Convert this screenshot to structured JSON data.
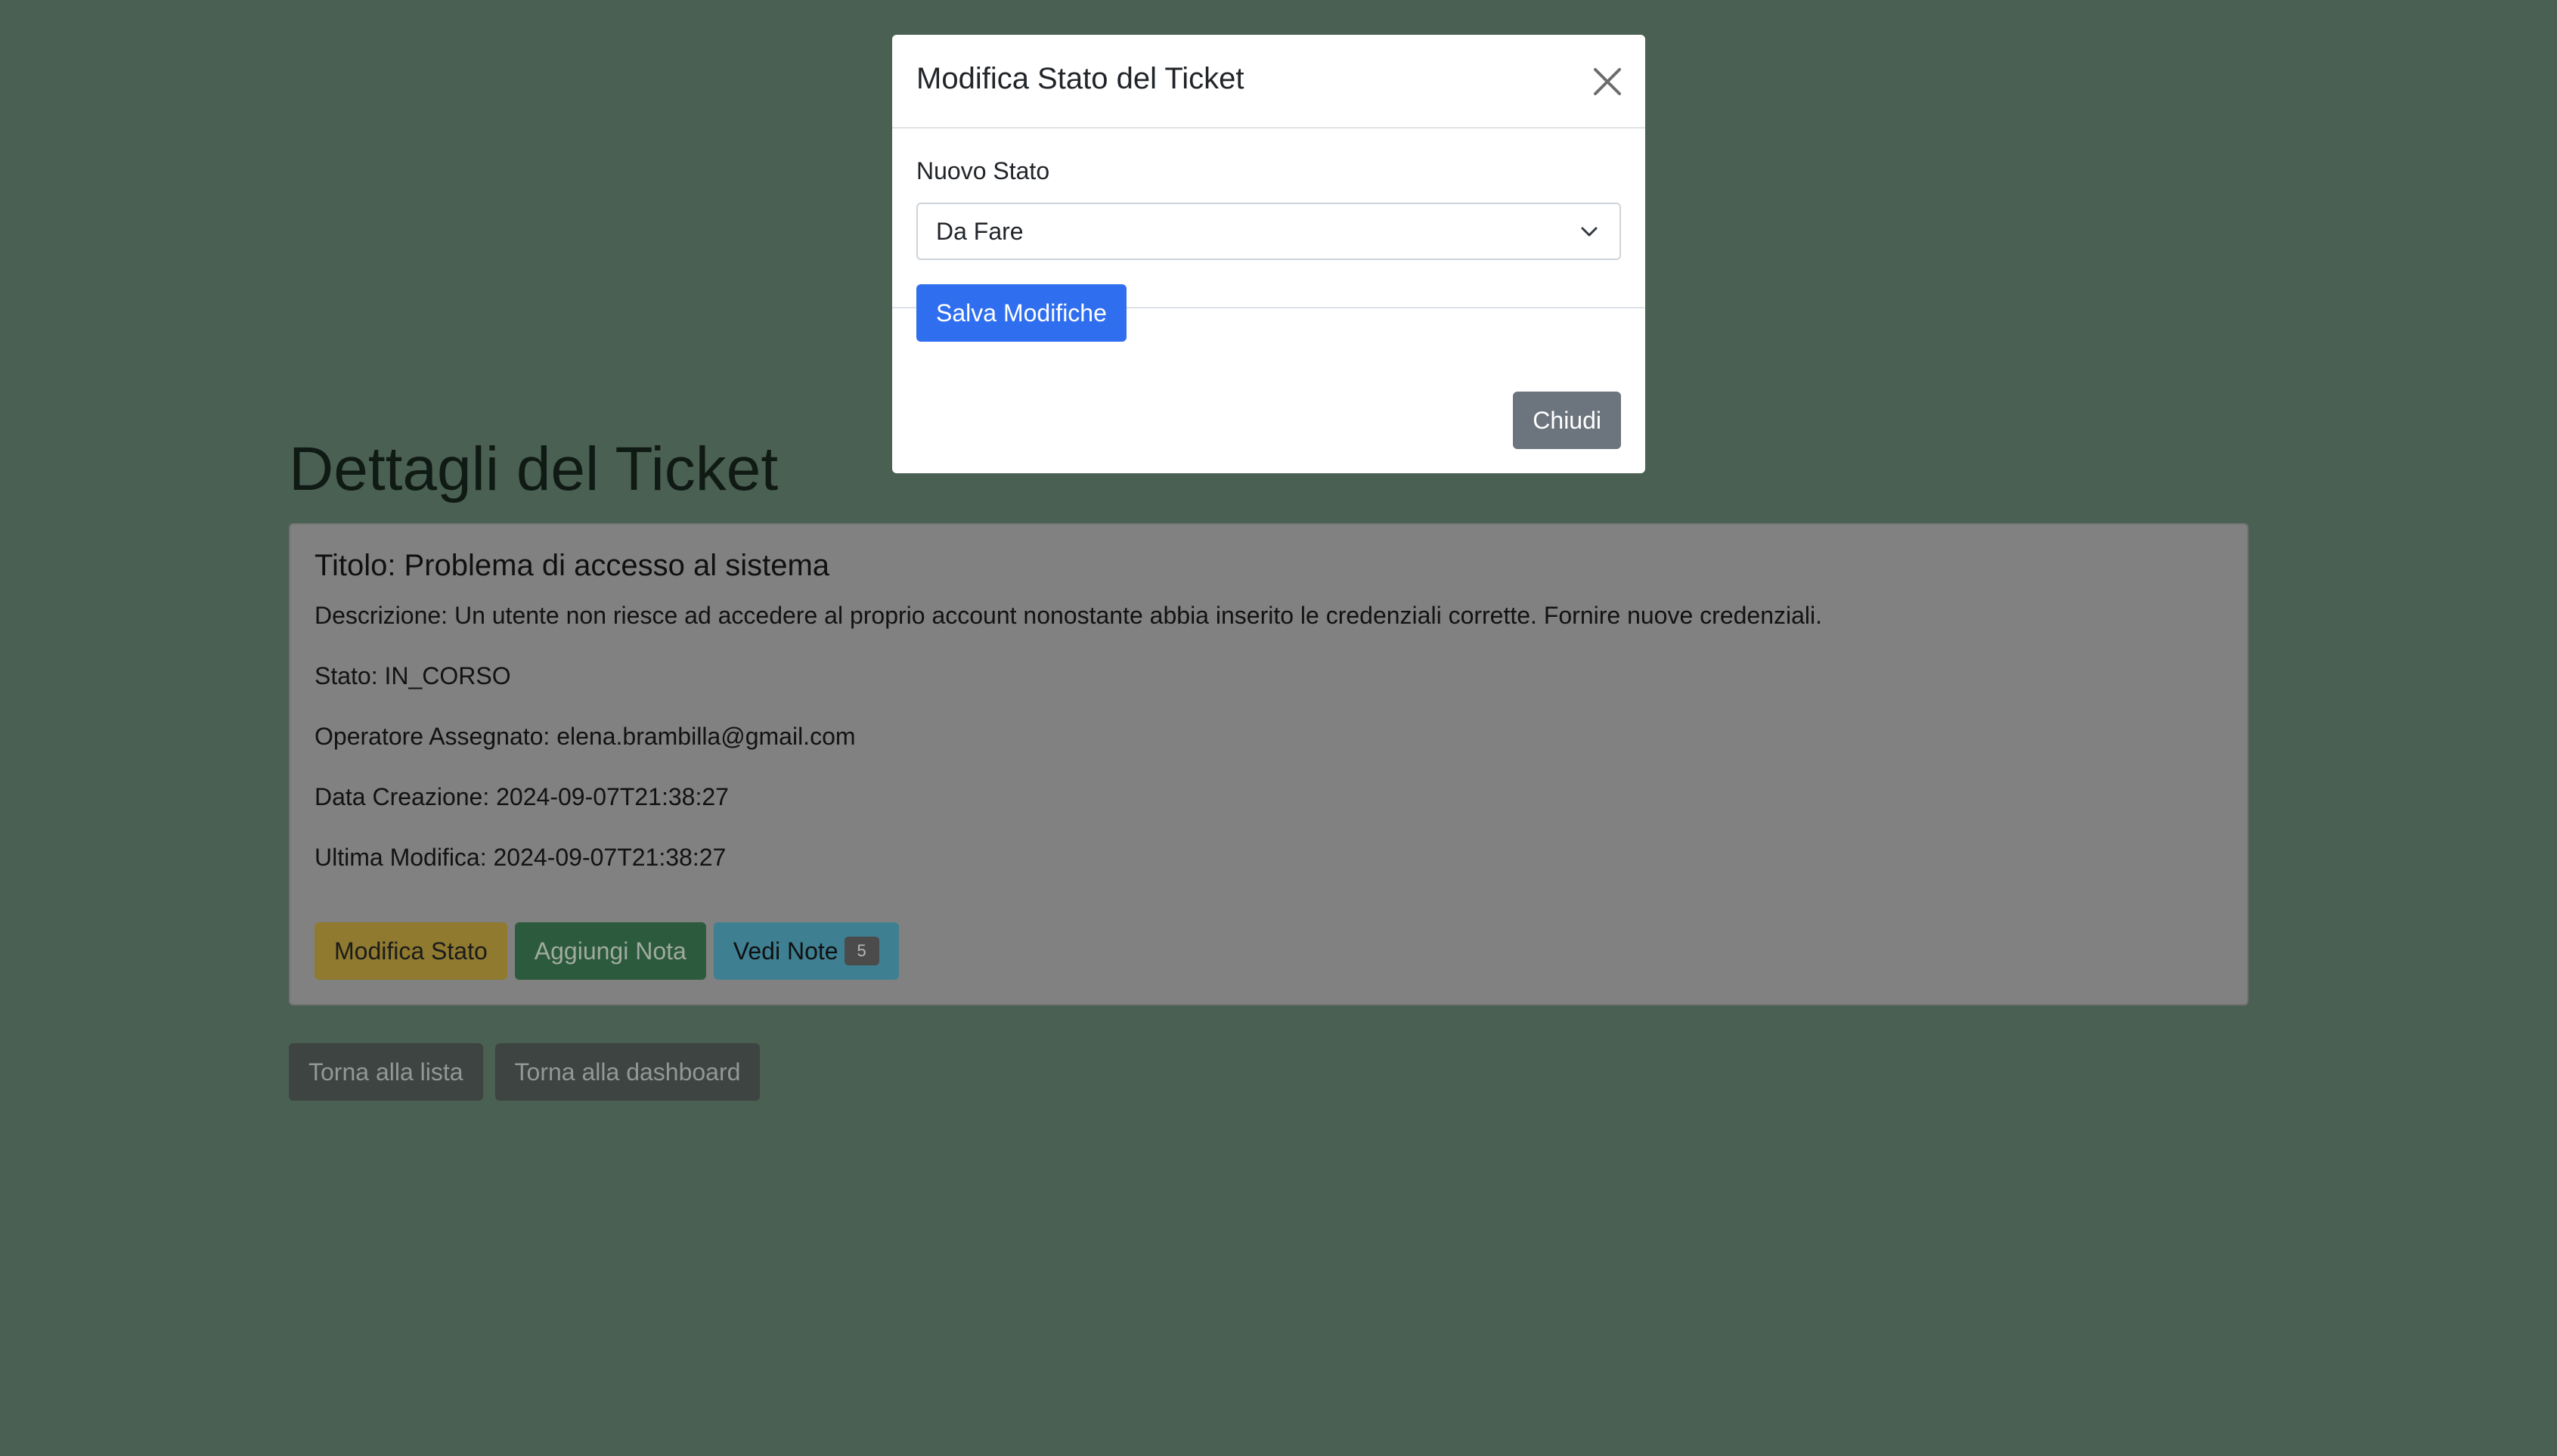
{
  "page": {
    "title": "Dettagli del Ticket"
  },
  "ticket": {
    "title": "Titolo: Problema di accesso al sistema",
    "description": "Descrizione: Un utente non riesce ad accedere al proprio account nonostante abbia inserito le credenziali corrette. Fornire nuove credenziali.",
    "status": "Stato: IN_CORSO",
    "operator": "Operatore Assegnato: elena.brambilla@gmail.com",
    "created": "Data Creazione: 2024-09-07T21:38:27",
    "modified": "Ultima Modifica: 2024-09-07T21:38:27"
  },
  "ticket_actions": {
    "edit_status": "Modifica Stato",
    "add_note": "Aggiungi Nota",
    "view_notes": "Vedi Note",
    "notes_count": "5"
  },
  "page_actions": {
    "back_to_list": "Torna alla lista",
    "back_to_dashboard": "Torna alla dashboard"
  },
  "modal": {
    "title": "Modifica Stato del Ticket",
    "close_icon": "close-icon",
    "field_label": "Nuovo Stato",
    "selected_status": "Da Fare",
    "save_label": "Salva Modifiche",
    "close_label": "Chiudi"
  },
  "colors": {
    "backdrop": "#4a6053",
    "primary": "#2f6fef",
    "secondary": "#6c757d",
    "warning": "#ffc107",
    "success": "#198754",
    "info": "#0dcaf0"
  }
}
